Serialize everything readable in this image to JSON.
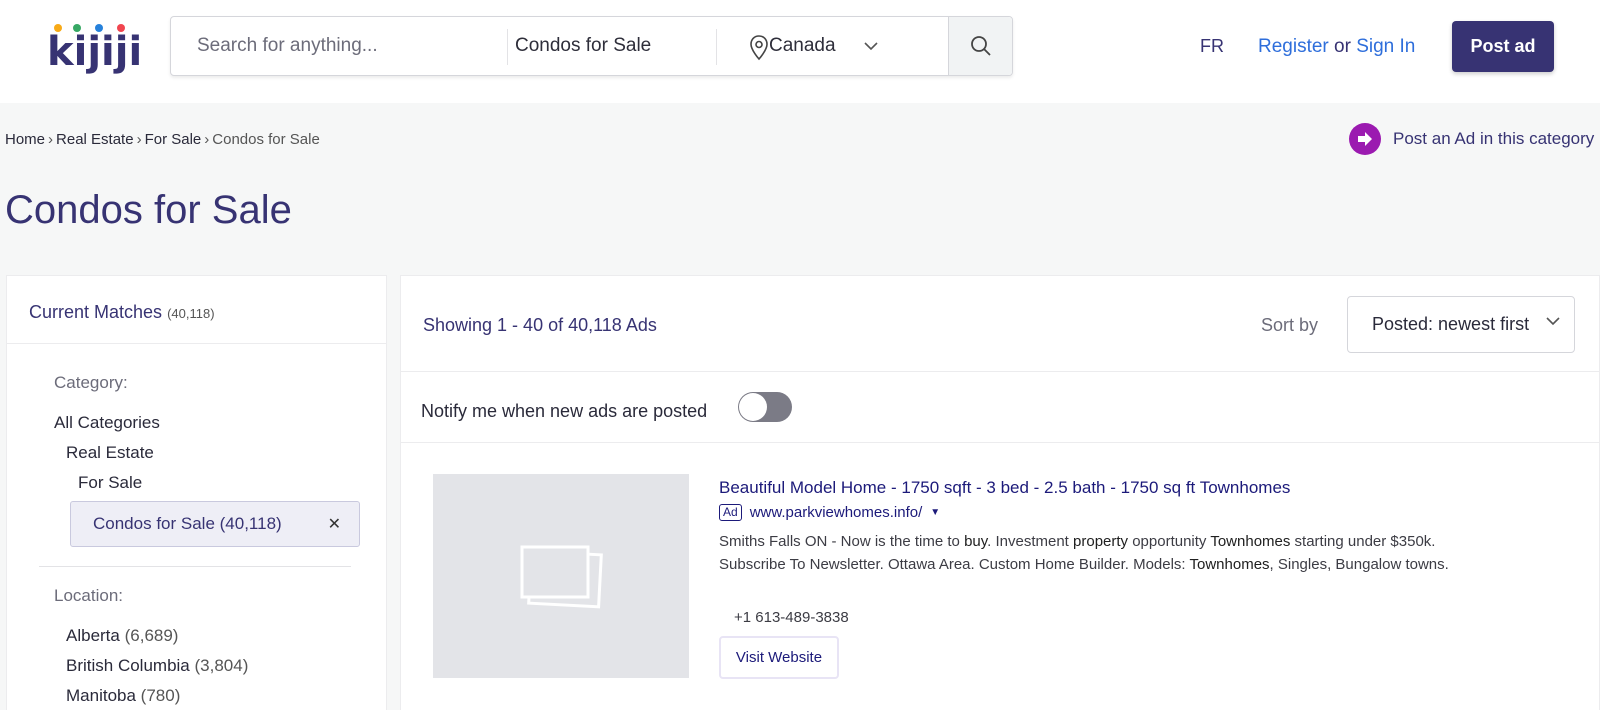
{
  "header": {
    "logo_letters": [
      "k",
      "i",
      "j",
      "i",
      "j",
      "i"
    ],
    "search_placeholder": "Search for anything...",
    "category_selected": "Condos for Sale",
    "location": "Canada",
    "lang_toggle": "FR",
    "register_label": "Register",
    "or_label": "or",
    "signin_label": "Sign In",
    "post_ad_label": "Post ad",
    "colors": {
      "brand": "#373373",
      "link": "#2e6edb"
    }
  },
  "breadcrumb": {
    "items": [
      "Home",
      "Real Estate",
      "For Sale"
    ],
    "current": "Condos for Sale"
  },
  "post_in_category_label": "Post an Ad in this category",
  "page_title": "Condos for Sale",
  "sidebar": {
    "current_matches_label": "Current Matches",
    "current_matches_count": "(40,118)",
    "category_label": "Category:",
    "categories": [
      {
        "label": "All Categories"
      },
      {
        "label": "Real Estate"
      },
      {
        "label": "For Sale"
      }
    ],
    "selected_category": "Condos for Sale (40,118)",
    "location_label": "Location:",
    "locations": [
      {
        "name": "Alberta",
        "count": "(6,689)"
      },
      {
        "name": "British Columbia",
        "count": "(3,804)"
      },
      {
        "name": "Manitoba",
        "count": "(780)"
      }
    ]
  },
  "results": {
    "showing_text": "Showing 1 - 40 of 40,118 Ads",
    "sort_label": "Sort by",
    "sort_selected": "Posted: newest first",
    "notify_label": "Notify me when new ads are posted",
    "notify_enabled": false
  },
  "ad": {
    "title": "Beautiful Model Home - 1750 sqft - 3 bed - 2.5 bath - 1750 sq ft Townhomes",
    "badge": "Ad",
    "url_prefix": "www.parkview",
    "url_bold": "homes",
    "url_suffix": ".info/",
    "desc_1": "Smiths Falls ON - Now is the time to ",
    "desc_b1": "buy",
    "desc_2": ". Investment ",
    "desc_b2": "property",
    "desc_3": " opportunity ",
    "desc_b3": "Townhomes",
    "desc_4": " starting under $350k. Subscribe To Newsletter. Ottawa Area. Custom Home Builder. Models: ",
    "desc_b4": "Townhomes",
    "desc_5": ", Singles, Bungalow towns.",
    "phone": "+1 613-489-3838",
    "visit_label": "Visit Website"
  }
}
